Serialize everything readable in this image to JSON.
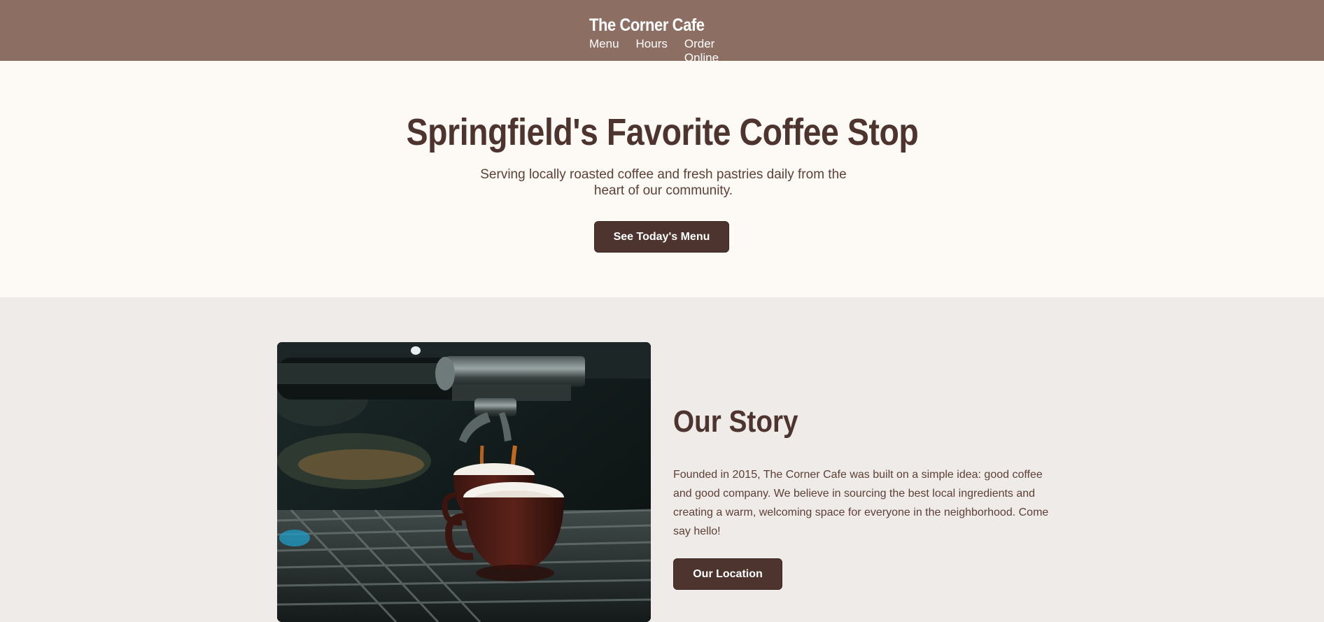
{
  "header": {
    "brand": "The Corner Cafe",
    "nav": [
      {
        "label": "Menu"
      },
      {
        "label": "Hours"
      },
      {
        "label": "Order Online"
      }
    ]
  },
  "hero": {
    "title": "Springfield's Favorite Coffee Stop",
    "subtitle": "Serving locally roasted coffee and fresh pastries daily from the heart of our community.",
    "cta_label": "See Today's Menu"
  },
  "story": {
    "title": "Our Story",
    "body": "Founded in 2015, The Corner Cafe was built on a simple idea: good coffee and good company. We believe in sourcing the best local ingredients and creating a warm, welcoming space for everyone in the neighborhood. Come say hello!",
    "cta_label": "Our Location",
    "image": "espresso-machine-photo"
  },
  "colors": {
    "header_bg": "#8d6e63",
    "hero_bg": "#fdfaf5",
    "section_bg": "#efebe8",
    "accent": "#4e342e"
  }
}
